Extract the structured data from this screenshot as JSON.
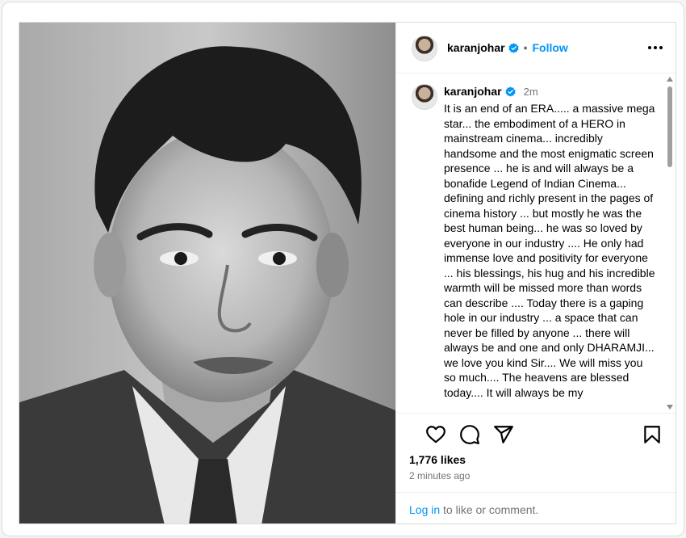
{
  "post": {
    "author": "karanjohar",
    "follow_label": "Follow",
    "dot": "•",
    "time_short": "2m",
    "caption": "It is an end of an ERA..... a massive mega star... the embodiment of a HERO in mainstream cinema... incredibly handsome and the most  enigmatic screen presence ... he is and will always be a bonafide Legend of Indian Cinema... defining and richly present in the pages of cinema history ... but mostly he was the best human being... he was so loved by everyone in our industry .... He only had immense love and positivity for everyone ... his blessings, his hug and his incredible warmth will be missed more than words can describe .... Today there is a gaping hole in our industry ... a space that can never be filled by anyone ... there will always be and one and only DHARAMJI... we love you kind Sir.... We will miss you so much.... The heavens are blessed today.... It will always be my",
    "likes": "1,776 likes",
    "time_full": "2 minutes ago",
    "login_link": "Log in",
    "login_rest": " to like or comment.",
    "verified_color": "#0095f6",
    "accent_color": "#0095f6"
  },
  "icons": {
    "like": "heart-icon",
    "comment": "comment-icon",
    "share": "share-icon",
    "save": "bookmark-icon",
    "more": "more-icon"
  }
}
